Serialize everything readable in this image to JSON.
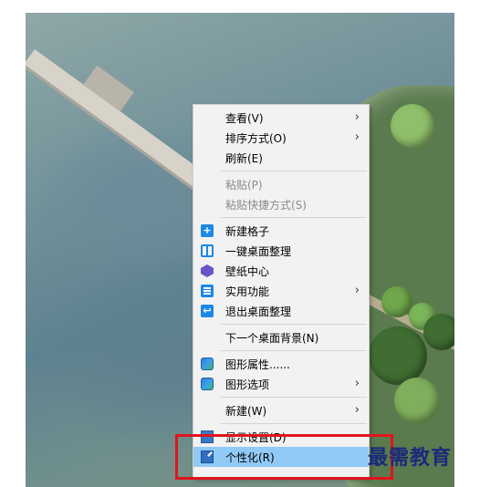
{
  "context_menu": {
    "items": [
      {
        "label": "查看(V)",
        "submenu": true,
        "enabled": true,
        "icon": ""
      },
      {
        "label": "排序方式(O)",
        "submenu": true,
        "enabled": true,
        "icon": ""
      },
      {
        "label": "刷新(E)",
        "submenu": false,
        "enabled": true,
        "icon": ""
      },
      {
        "label": "粘贴(P)",
        "submenu": false,
        "enabled": false,
        "icon": ""
      },
      {
        "label": "粘贴快捷方式(S)",
        "submenu": false,
        "enabled": false,
        "icon": ""
      },
      {
        "label": "新建格子",
        "submenu": false,
        "enabled": true,
        "icon": "plus-icon"
      },
      {
        "label": "一键桌面整理",
        "submenu": false,
        "enabled": true,
        "icon": "desktop-tidy-icon"
      },
      {
        "label": "壁纸中心",
        "submenu": false,
        "enabled": true,
        "icon": "wallpaper-icon"
      },
      {
        "label": "实用功能",
        "submenu": true,
        "enabled": true,
        "icon": "tools-icon"
      },
      {
        "label": "退出桌面整理",
        "submenu": false,
        "enabled": true,
        "icon": "exit-icon"
      },
      {
        "label": "下一个桌面背景(N)",
        "submenu": false,
        "enabled": true,
        "icon": ""
      },
      {
        "label": "图形属性......",
        "submenu": false,
        "enabled": true,
        "icon": "graphics-icon"
      },
      {
        "label": "图形选项",
        "submenu": true,
        "enabled": true,
        "icon": "graphics-icon"
      },
      {
        "label": "新建(W)",
        "submenu": true,
        "enabled": true,
        "icon": ""
      },
      {
        "label": "显示设置(D)",
        "submenu": false,
        "enabled": true,
        "icon": "display-settings-icon"
      },
      {
        "label": "个性化(R)",
        "submenu": false,
        "enabled": true,
        "highlighted": true,
        "icon": "personalize-icon"
      }
    ],
    "submenu_arrow": "›"
  },
  "watermark": {
    "text": "最需教育",
    "color": "#1a2a7a"
  },
  "colors": {
    "highlight": "#91c9f7",
    "annotation_box": "#e0141e",
    "icon_blue": "#1e88e5"
  }
}
